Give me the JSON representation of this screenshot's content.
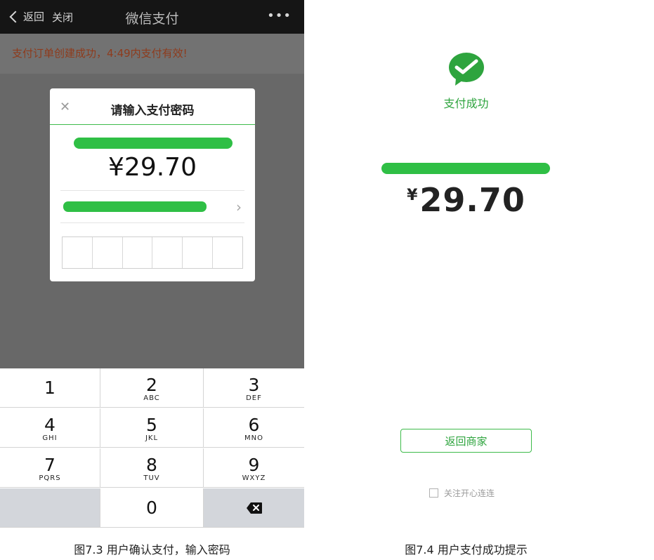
{
  "left": {
    "top_bar": {
      "back_label": "返回",
      "close_label": "关闭",
      "title": "微信支付",
      "more": "•••"
    },
    "notice": "支付订单创建成功，4:49内支付有效!",
    "dialog": {
      "close": "✕",
      "title": "请输入支付密码",
      "amount": "¥29.70",
      "card_chevron": "›",
      "pin_cells": 6
    },
    "keypad": {
      "keys": [
        {
          "num": "1",
          "letters": ""
        },
        {
          "num": "2",
          "letters": "ABC"
        },
        {
          "num": "3",
          "letters": "DEF"
        },
        {
          "num": "4",
          "letters": "GHI"
        },
        {
          "num": "5",
          "letters": "JKL"
        },
        {
          "num": "6",
          "letters": "MNO"
        },
        {
          "num": "7",
          "letters": "PQRS"
        },
        {
          "num": "8",
          "letters": "TUV"
        },
        {
          "num": "9",
          "letters": "WXYZ"
        },
        {
          "num": "0",
          "letters": ""
        }
      ]
    },
    "caption": "图7.3 用户确认支付，输入密码"
  },
  "right": {
    "success_text": "支付成功",
    "amount_currency": "¥",
    "amount_value": "29.70",
    "return_button": "返回商家",
    "follow_label": "关注开心连连",
    "caption": "图7.4 用户支付成功提示"
  },
  "colors": {
    "brand_green": "#2fbf45",
    "notice_red": "#8e3b1c"
  }
}
